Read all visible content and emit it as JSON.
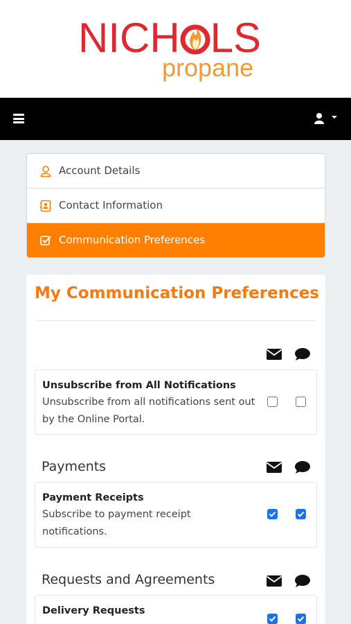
{
  "brand": {
    "name_left": "NICH",
    "name_right": "LS",
    "sub": "propane",
    "primary_color": "#e0282e",
    "secondary_color": "#f39a34"
  },
  "topbar": {
    "menu_icon": "hamburger-icon",
    "user_icon": "user-icon"
  },
  "nav": {
    "items": [
      {
        "label": "Account Details",
        "icon": "user-icon",
        "active": false
      },
      {
        "label": "Contact Information",
        "icon": "contact-card-icon",
        "active": false
      },
      {
        "label": "Communication Preferences",
        "icon": "check-square-icon",
        "active": true
      }
    ],
    "active_color": "#ff7f00"
  },
  "main": {
    "title": "My Communication Preferences",
    "column_icons": [
      "envelope-icon",
      "comment-icon"
    ],
    "unsubscribe": {
      "name": "Unsubscribe from All Notifications",
      "desc_line1": "Unsubscribe from all notifications sent out",
      "desc_line2": "by the Online Portal.",
      "email": false,
      "sms": false
    },
    "sections": [
      {
        "title": "Payments",
        "items": [
          {
            "name": "Payment Receipts",
            "desc_line1": "Subscribe to payment receipt",
            "desc_line2": "notifications.",
            "email": true,
            "sms": true
          }
        ]
      },
      {
        "title": "Requests and Agreements",
        "items": [
          {
            "name": "Delivery Requests",
            "email": true,
            "sms": true
          }
        ]
      }
    ]
  }
}
